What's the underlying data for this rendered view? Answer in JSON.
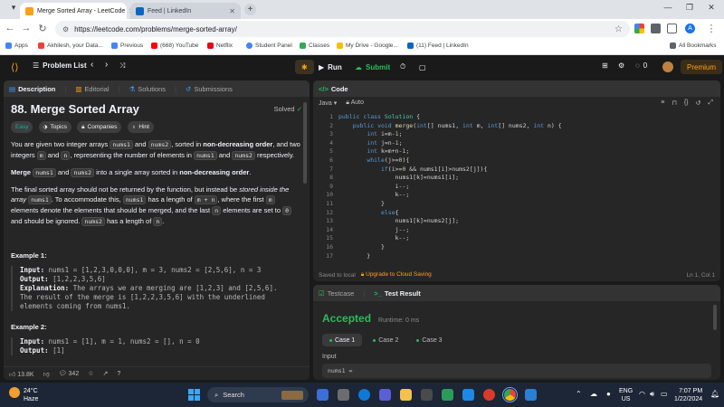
{
  "browser": {
    "tabs": [
      {
        "title": "Merge Sorted Array - LeetCode",
        "active": true,
        "favicon_color": "#f89f1b"
      },
      {
        "title": "Feed | LinkedIn",
        "active": false,
        "favicon_color": "#0a66c2"
      }
    ],
    "url": "https://leetcode.com/problems/merge-sorted-array/",
    "bookmarks": [
      {
        "label": "Apps",
        "icon": "apps-grid-icon",
        "color": "#4285f4"
      },
      {
        "label": "Akhilesh, your Data...",
        "icon": "gmail-icon",
        "color": "#ea4335"
      },
      {
        "label": "Previous",
        "icon": "previous-icon",
        "color": "#4285f4"
      },
      {
        "label": "(668) YouTube",
        "icon": "youtube-icon",
        "color": "#ff0000"
      },
      {
        "label": "Netflix",
        "icon": "netflix-icon",
        "color": "#e50914"
      },
      {
        "label": "Student Panel",
        "icon": "globe-icon",
        "color": "#4285f4"
      },
      {
        "label": "Classes",
        "icon": "classroom-icon",
        "color": "#34a853"
      },
      {
        "label": "My Drive - Google...",
        "icon": "drive-icon",
        "color": "#fbbc04"
      },
      {
        "label": "(11) Feed | LinkedIn",
        "icon": "linkedin-icon",
        "color": "#0a66c2"
      }
    ],
    "all_bookmarks": "All Bookmarks",
    "profile_initial": "A"
  },
  "nav": {
    "problem_list": "Problem List",
    "run": "Run",
    "submit": "Submit",
    "streak": "0",
    "premium": "Premium"
  },
  "description": {
    "tabs": [
      "Description",
      "Editorial",
      "Solutions",
      "Submissions"
    ],
    "title": "88. Merge Sorted Array",
    "solved": "Solved",
    "chips": {
      "difficulty": "Easy",
      "topics": "Topics",
      "companies": "Companies",
      "hint": "Hint"
    },
    "p1": {
      "a": "You are given two integer arrays ",
      "c1": "nums1",
      "b": " and ",
      "c2": "nums2",
      "c": ", sorted in ",
      "bold1": "non-decreasing order",
      "d": ", and two integers ",
      "c3": "m",
      "e": " and ",
      "c4": "n",
      "f": ", representing the number of elements in ",
      "c5": "nums1",
      "g": " and ",
      "c6": "nums2",
      "h": " respectively."
    },
    "p2": {
      "bold1": "Merge",
      "c1": "nums1",
      "a": " and ",
      "c2": "nums2",
      "b": " into a single array sorted in ",
      "bold2": "non-decreasing order",
      "c": "."
    },
    "p3": {
      "a": "The final sorted array should not be returned by the function, but instead be ",
      "em1": "stored inside the array",
      "c1": "nums1",
      "b": ". To accommodate this, ",
      "c2": "nums1",
      "c": " has a length of ",
      "c3": "m + n",
      "d": ", where the first ",
      "c4": "m",
      "e": " elements denote the elements that should be merged, and the last ",
      "c5": "n",
      "f": " elements are set to ",
      "c6": "0",
      "g": " and should be ignored. ",
      "c7": "nums2",
      "h": " has a length of ",
      "c8": "n",
      "i": "."
    },
    "example1": {
      "title": "Example 1:",
      "input_label": "Input:",
      "input": "nums1 = [1,2,3,0,0,0], m = 3, nums2 = [2,5,6], n = 3",
      "output_label": "Output:",
      "output": "[1,2,2,3,5,6]",
      "expl_label": "Explanation:",
      "expl1": "The arrays we are merging are [1,2,3] and [2,5,6].",
      "expl2": "The result of the merge is [1,2,2,3,5,6] with the underlined",
      "expl3": "elements coming from nums1."
    },
    "example2": {
      "title": "Example 2:",
      "input_label": "Input:",
      "input": "nums1 = [1], m = 1, nums2 = [], n = 0",
      "output_label": "Output:",
      "output": "[1]"
    },
    "footer": {
      "likes": "13.8K",
      "comments": "342"
    }
  },
  "code": {
    "header": "Code",
    "language": "Java",
    "mode": "Auto",
    "lines": [
      "public class Solution {",
      "    public void merge(int[] nums1, int m, int[] nums2, int n) {",
      "        int i=m-1;",
      "        int j=n-1;",
      "        int k=m+n-1;",
      "        while(j>=0){",
      "            if(i>=0 && nums1[i]>nums2[j]){",
      "                nums1[k]=nums1[i];",
      "                i--;",
      "                k--;",
      "            }",
      "            else{",
      "                nums1[k]=nums2[j];",
      "                j--;",
      "                k--;",
      "            }",
      "        }"
    ],
    "line_numbers": [
      "1",
      "2",
      "3",
      "4",
      "5",
      "6",
      "7",
      "8",
      "9",
      "10",
      "11",
      "12",
      "13",
      "14",
      "15",
      "16",
      "17"
    ],
    "status_left": "Saved to local",
    "upgrade": "Upgrade to Cloud Saving",
    "cursor": "Ln 1, Col 1"
  },
  "test": {
    "tabs": [
      "Testcase",
      "Test Result"
    ],
    "result": "Accepted",
    "runtime": "Runtime: 0 ms",
    "cases": [
      "Case 1",
      "Case 2",
      "Case 3"
    ],
    "input_label": "Input",
    "input_value": "nums1 ="
  },
  "taskbar": {
    "weather_temp": "24°C",
    "weather_desc": "Haze",
    "search": "Search",
    "lang": "ENG",
    "region": "US",
    "time": "7:07 PM",
    "date": "1/22/2024"
  }
}
